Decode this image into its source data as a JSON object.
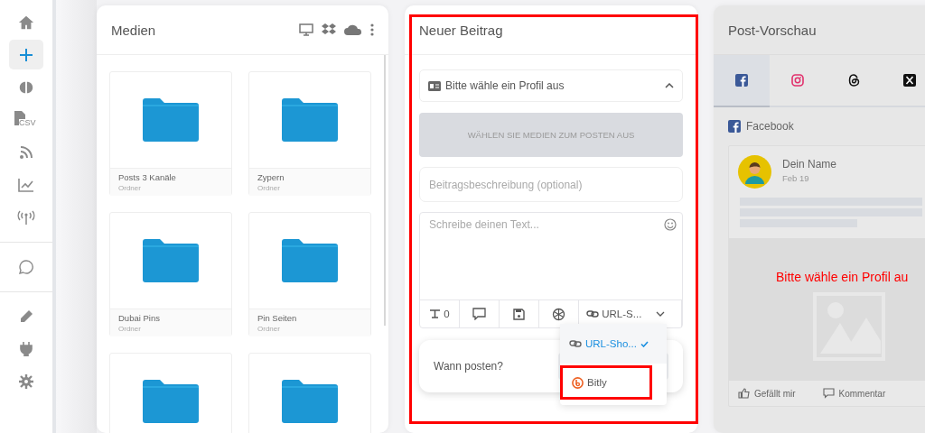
{
  "sidebar": {
    "items": [
      {
        "kind": "home",
        "selected": false
      },
      {
        "kind": "plus",
        "selected": true
      },
      {
        "kind": "brain",
        "selected": false
      },
      {
        "kind": "csv",
        "label": "CSV",
        "selected": false
      },
      {
        "kind": "rss",
        "selected": false
      },
      {
        "kind": "chart",
        "selected": false
      },
      {
        "kind": "antenna",
        "selected": false
      },
      {
        "kind": "whatsapp",
        "selected": false
      },
      {
        "kind": "pencil",
        "selected": false
      },
      {
        "kind": "plug",
        "selected": false
      },
      {
        "kind": "gear",
        "selected": false
      }
    ]
  },
  "media": {
    "title": "Medien",
    "folders": [
      {
        "kind": "folder",
        "name": "Posts 3 Kanäle",
        "type": "Ordner"
      },
      {
        "kind": "folder",
        "name": "Zypern",
        "type": "Ordner"
      },
      {
        "kind": "folder",
        "name": "Dubai Pins",
        "type": "Ordner"
      },
      {
        "kind": "folder",
        "name": "Pin Seiten",
        "type": "Ordner"
      },
      {
        "kind": "folder"
      },
      {
        "kind": "folder"
      }
    ]
  },
  "composer": {
    "title": "Neuer Beitrag",
    "profile_select": {
      "placeholder": "Bitte wähle ein Profil aus",
      "expanded": true
    },
    "media_button": {
      "label": "WÄHLEN SIE MEDIEN ZUM POSTEN AUS",
      "disabled": true
    },
    "description": {
      "placeholder": "Beitragsbeschreibung (optional)"
    },
    "text": {
      "placeholder": "Schreibe deinen Text..."
    },
    "toolbar": [
      {
        "kind": "counter",
        "label": "0"
      },
      {
        "kind": "comment"
      },
      {
        "kind": "save"
      },
      {
        "kind": "ai"
      },
      {
        "kind": "shortener",
        "label": "URL-S..."
      }
    ],
    "shortener_menu": [
      {
        "kind": "link",
        "label": "URL-Sho...",
        "selected": true,
        "highlighted": false
      },
      {
        "kind": "bitly",
        "label": "Bitly",
        "selected": false,
        "highlighted": true
      }
    ],
    "schedule": {
      "label": "Wann posten?"
    }
  },
  "preview": {
    "title": "Post-Vorschau",
    "tabs": [
      {
        "kind": "facebook",
        "selected": true
      },
      {
        "kind": "instagram",
        "selected": false
      },
      {
        "kind": "threads",
        "selected": false
      },
      {
        "kind": "x",
        "selected": false
      }
    ],
    "network": "Facebook",
    "post": {
      "name": "Dein Name",
      "date": "Feb 19",
      "message": "Bitte wähle ein Profil au"
    },
    "actions": [
      {
        "kind": "like",
        "label": "Gefällt mir"
      },
      {
        "kind": "comment",
        "label": "Kommentar"
      }
    ]
  }
}
